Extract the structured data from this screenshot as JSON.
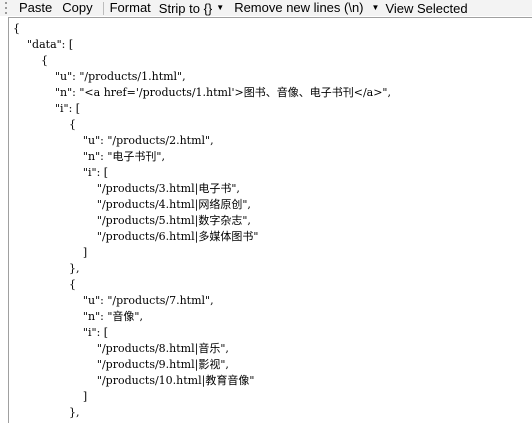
{
  "toolbar": {
    "paste_label": "Paste",
    "copy_label": "Copy",
    "format_label": "Format",
    "strip_label": "Strip to {}",
    "remove_newlines_label": "Remove new lines (\\n)",
    "view_selected_label": "View Selected"
  },
  "editor": {
    "lines": [
      "{",
      "    \"data\": [",
      "        {",
      "            \"u\": \"/products/1.html\",",
      "            \"n\": \"<a href='/products/1.html'>图书、音像、电子书刊</a>\",",
      "            \"i\": [",
      "                {",
      "                    \"u\": \"/products/2.html\",",
      "                    \"n\": \"电子书刊\",",
      "                    \"i\": [",
      "                        \"/products/3.html|电子书\",",
      "                        \"/products/4.html|网络原创\",",
      "                        \"/products/5.html|数字杂志\",",
      "                        \"/products/6.html|多媒体图书\"",
      "                    ]",
      "                },",
      "                {",
      "                    \"u\": \"/products/7.html\",",
      "                    \"n\": \"音像\",",
      "                    \"i\": [",
      "                        \"/products/8.html|音乐\",",
      "                        \"/products/9.html|影视\",",
      "                        \"/products/10.html|教育音像\"",
      "                    ]",
      "                },",
      "                {"
    ]
  }
}
